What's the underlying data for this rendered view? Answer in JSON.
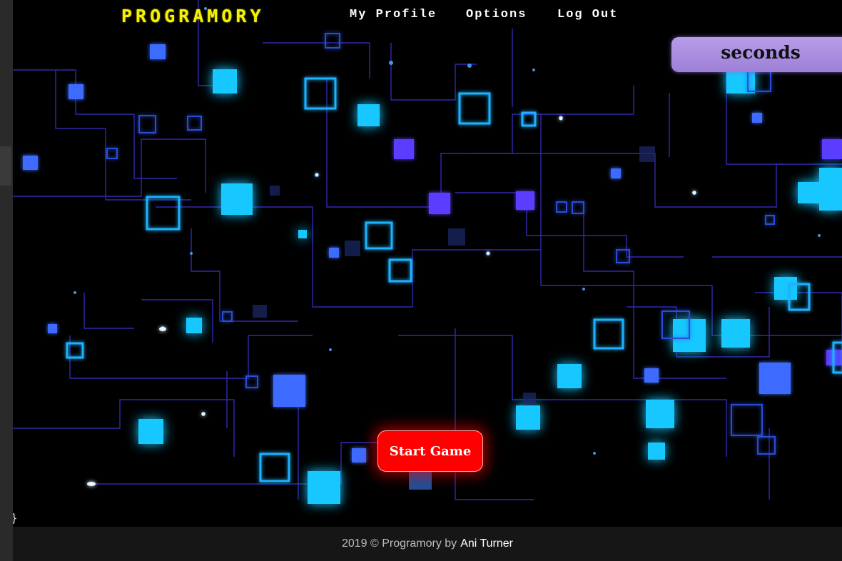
{
  "nav": {
    "brand": "PROGRAMORY",
    "links": [
      "My Profile",
      "Options",
      "Log Out"
    ]
  },
  "timer": {
    "label": "seconds"
  },
  "game": {
    "start_label": "Start Game"
  },
  "stray_text": "}",
  "footer": {
    "prefix": "2019 © Programory by",
    "author": "Ani Turner"
  },
  "colors": {
    "brand": "#f5f200",
    "start_button": "#ff0000",
    "timer_bg": "#b79ce8"
  }
}
